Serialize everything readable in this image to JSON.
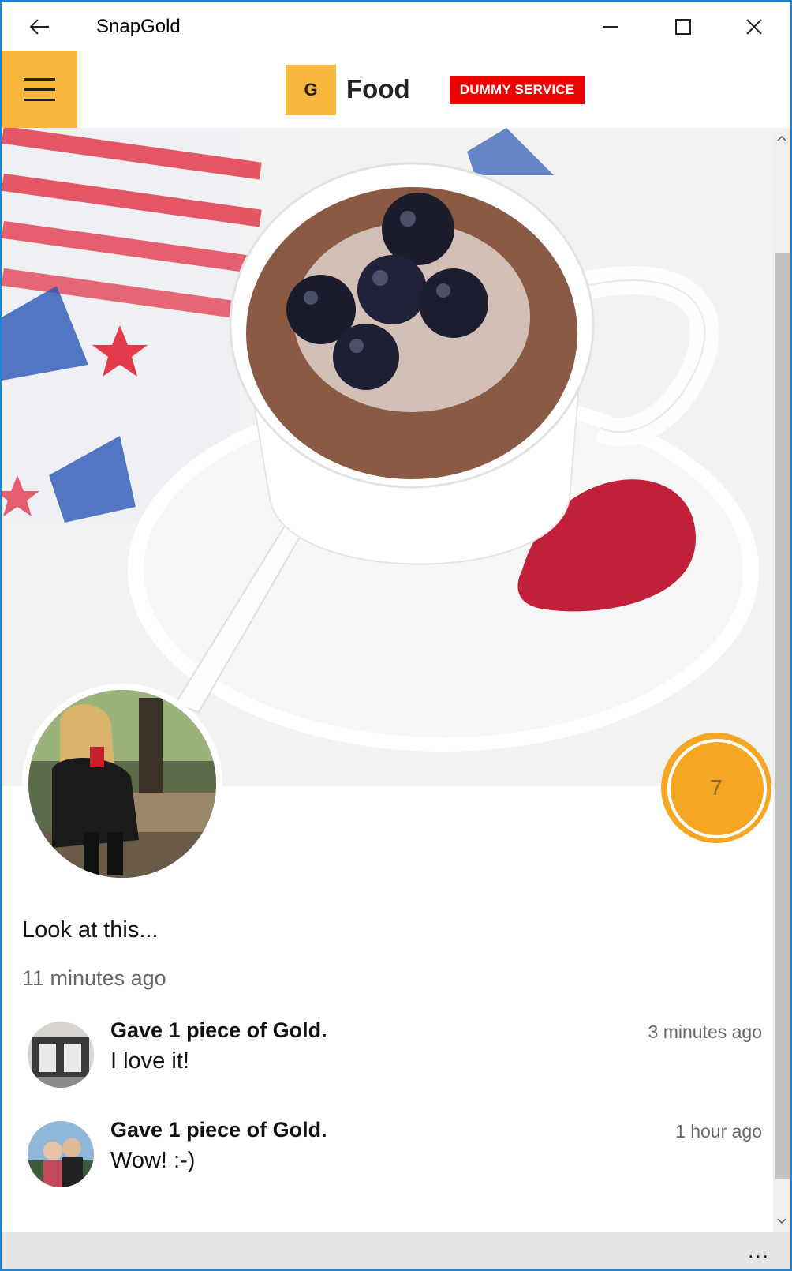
{
  "window": {
    "title": "SnapGold"
  },
  "header": {
    "logo_letter": "G",
    "title": "Food",
    "badge": "DUMMY SERVICE"
  },
  "post": {
    "gold_count": "7",
    "caption": "Look at this...",
    "time": "11 minutes ago"
  },
  "comments": [
    {
      "title": "Gave 1 piece of Gold.",
      "text": "I love it!",
      "time": "3 minutes ago"
    },
    {
      "title": "Gave 1 piece of Gold.",
      "text": "Wow! :-)",
      "time": "1 hour ago"
    }
  ],
  "bottom_bar": {
    "more_label": "..."
  },
  "icons": {
    "back": "back-arrow-icon",
    "minimize": "minimize-icon",
    "maximize": "maximize-icon",
    "close": "close-icon",
    "menu": "hamburger-menu-icon",
    "scroll_up": "chevron-up-icon",
    "scroll_down": "chevron-down-icon"
  },
  "colors": {
    "accent": "#f9b740",
    "gold_button": "#f5a623",
    "badge": "#ee0000",
    "window_border": "#1a84d8"
  }
}
